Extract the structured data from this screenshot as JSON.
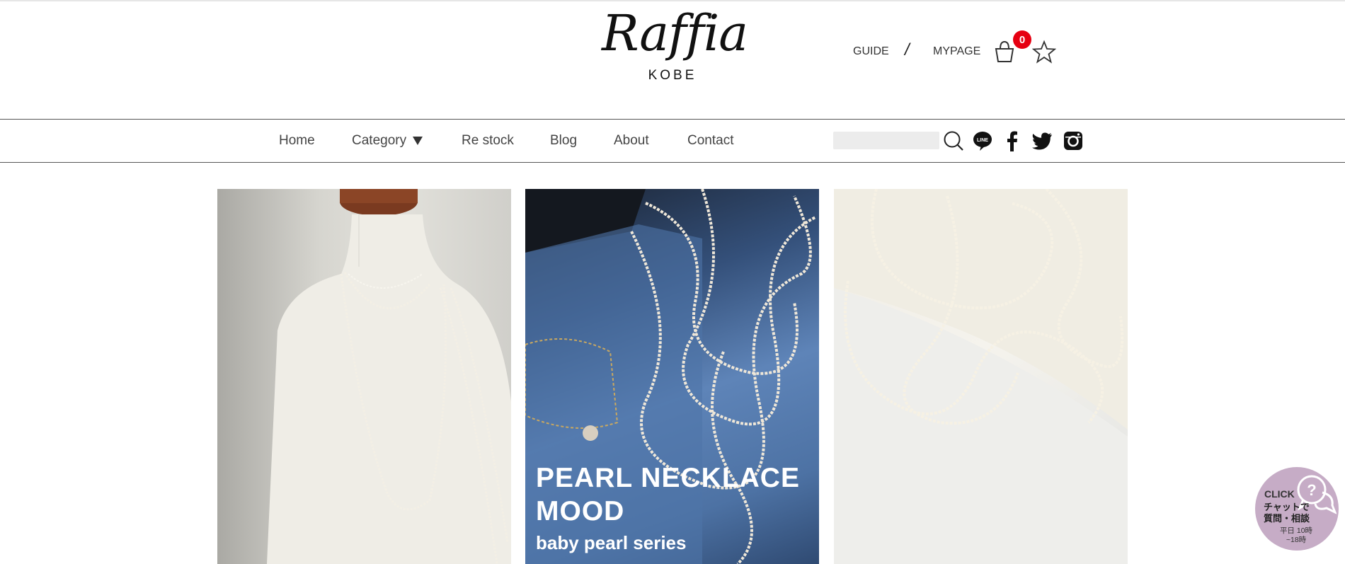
{
  "brand": {
    "logo_script": "Raffia",
    "logo_sub": "KOBE"
  },
  "header_links": {
    "guide": "GUIDE",
    "separator": "/",
    "mypage": "MYPAGE",
    "cart_count": "0"
  },
  "nav": {
    "items": [
      {
        "label": "Home"
      },
      {
        "label": "Category"
      },
      {
        "label": "Re stock"
      },
      {
        "label": "Blog"
      },
      {
        "label": "About"
      },
      {
        "label": "Contact"
      }
    ],
    "search_placeholder": "",
    "social": [
      "line-icon",
      "facebook-icon",
      "twitter-icon",
      "instagram-icon"
    ]
  },
  "banners": [
    {
      "image": "mannequin-pearl-necklace"
    },
    {
      "image": "pearls-on-denim",
      "title": "PEARL NECKLACE MOOD",
      "subtitle": "baby pearl series"
    },
    {
      "image": "pearls-on-white-fabric"
    }
  ],
  "chat_widget": {
    "click": "CLICK",
    "text": "チャットで 質問・相談",
    "hours": "平日 10時~18時"
  },
  "colors": {
    "badge": "#e60012",
    "chat_bg": "#bea0be",
    "text": "#333333"
  }
}
